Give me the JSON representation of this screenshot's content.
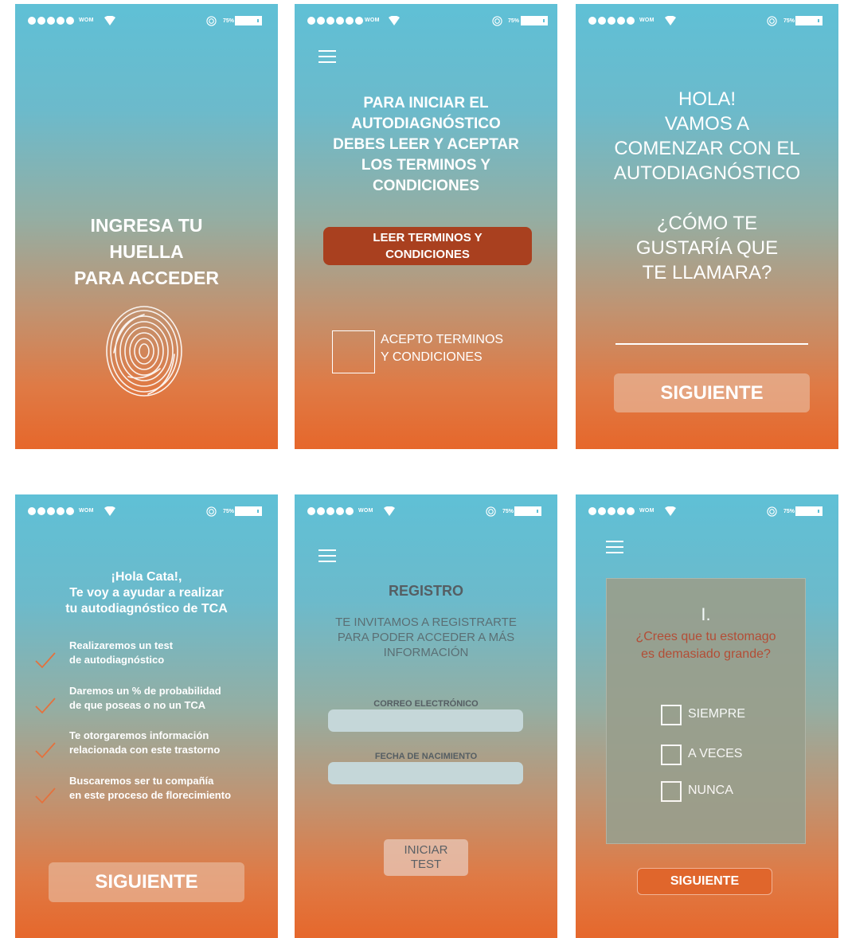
{
  "statusbar": {
    "carrier": "WOM",
    "battery_pct": "75%"
  },
  "screen1": {
    "title": "INGRESA TU\nHUELLA\nPARA ACCEDER"
  },
  "screen2": {
    "title": "PARA INICIAR EL\nAUTODIAGNÓSTICO\nDEBES LEER Y ACEPTAR\nLOS TERMINOS Y\nCONDICIONES",
    "read_button": "LEER TERMINOS Y\nCONDICIONES",
    "accept_label": "ACEPTO TERMINOS\nY CONDICIONES"
  },
  "screen3": {
    "greeting": "HOLA!\nVAMOS A\nCOMENZAR CON EL\nAUTODIAGNÓSTICO",
    "question": "¿CÓMO TE\nGUSTARÍA QUE\nTE LLAMARA?",
    "next_button": "SIGUIENTE"
  },
  "screen4": {
    "intro": "¡Hola Cata!,\nTe voy a ayudar a realizar\ntu autodiagnóstico de TCA",
    "benefits": [
      "Realizaremos un test\nde autodiagnóstico",
      "Daremos un % de probabilidad\nde que poseas o no un TCA",
      "Te otorgaremos información\nrelacionada con este trastorno",
      "Buscaremos ser tu compañía\nen este proceso de florecimiento"
    ],
    "next_button": "SIGUIENTE"
  },
  "screen5": {
    "title": "REGISTRO",
    "subtitle": "TE INVITAMOS A REGISTRARTE\nPARA PODER ACCEDER A MÁS\nINFORMACIÓN",
    "email_label": "CORREO ELECTRÓNICO",
    "birth_label": "FECHA DE NACIMIENTO",
    "start_button": "INICIAR\nTEST"
  },
  "screen6": {
    "question_number": "I.",
    "question": "¿Crees que tu estomago\nes demasiado grande?",
    "options": [
      "SIEMPRE",
      "A VECES",
      "NUNCA"
    ],
    "next_button": "SIGUIENTE"
  },
  "colors": {
    "gradient_top": "#5fc0d6",
    "gradient_bottom": "#e6672b",
    "primary_button": "#a9401f",
    "accent_orange": "#e0662c",
    "question_text": "#b8452b"
  }
}
